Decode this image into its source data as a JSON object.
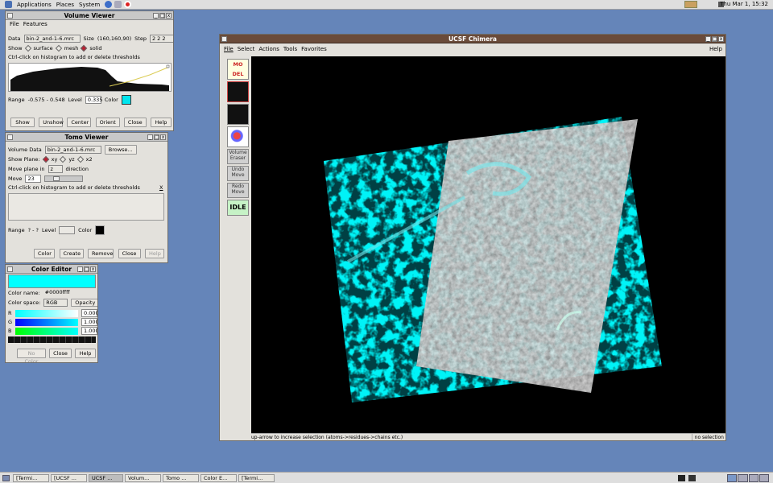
{
  "topbar": {
    "menus": [
      "Applications",
      "Places",
      "System"
    ],
    "clock": "Thu Mar  1, 15:32"
  },
  "volume_viewer": {
    "title": "Volume Viewer",
    "menu": [
      "File",
      "Features"
    ],
    "data_label": "Data",
    "data_value": "bin-2_and-1-6.mrc",
    "size_label": "Size",
    "size_value": "(160,160,90)",
    "step_label": "Step",
    "step_value": "2 2 2",
    "show_label": "Show",
    "opt_surface": "surface",
    "opt_mesh": "mesh",
    "opt_solid": "solid",
    "hint": "Ctrl-click on histogram to add or delete thresholds",
    "range_label": "Range",
    "range_value": "-0.575 - 0.548",
    "level_label": "Level",
    "level_value": "0.335",
    "color_label": "Color",
    "color": "#00e5ee",
    "buttons": [
      "Show",
      "Unshow",
      "Center",
      "Orient",
      "Close",
      "Help"
    ]
  },
  "tomo_viewer": {
    "title": "Tomo Viewer",
    "volume_label": "Volume Data",
    "volume_value": "bin-2_and-1-6.mrc",
    "browse": "Browse...",
    "plane_label": "Show Plane:",
    "plane_xy": "xy",
    "plane_yz": "yz",
    "plane_x2": "x2",
    "move_plane_label": "Move plane in",
    "move_plane_value": "z",
    "direction": "direction",
    "move_label": "Move",
    "move_value": "23",
    "hint": "Ctrl-click on histogram to add or delete thresholds",
    "close_x": "X",
    "range_label": "Range",
    "range_value": "? - ?",
    "level_label": "Level",
    "level_value": "",
    "color_label": "Color",
    "color": "#000000",
    "buttons": [
      "Color",
      "Create",
      "Remove",
      "Close",
      "Help"
    ]
  },
  "color_editor": {
    "title": "Color Editor",
    "preview_color": "#00ffff",
    "name_label": "Color name:",
    "name_value": "#0000ffff",
    "space_label": "Color space:",
    "space_value": "RGB",
    "opacity": "Opacity",
    "channels": [
      {
        "label": "R",
        "value": "0.000"
      },
      {
        "label": "G",
        "value": "1.000"
      },
      {
        "label": "B",
        "value": "1.000"
      }
    ],
    "buttons": [
      "No Color",
      "Close",
      "Help"
    ]
  },
  "chimera": {
    "title": "UCSF Chimera",
    "menu": [
      "File",
      "Select",
      "Actions",
      "Tools",
      "Favorites"
    ],
    "help": "Help",
    "side_logo": "MO DEL",
    "side_buttons": [
      "Volume Eraser",
      "Undo Move",
      "Redo Move"
    ],
    "idle": "IDLE",
    "status_left": "up-arrow to increase selection (atoms->residues->chains etc.)",
    "status_right": "no selection"
  },
  "taskbar": {
    "items": [
      "[Termi...",
      "[UCSF ...",
      "UCSF ...",
      "Volum...",
      "Tomo ...",
      "Color E...",
      "[Termi..."
    ],
    "active_index": 2
  }
}
